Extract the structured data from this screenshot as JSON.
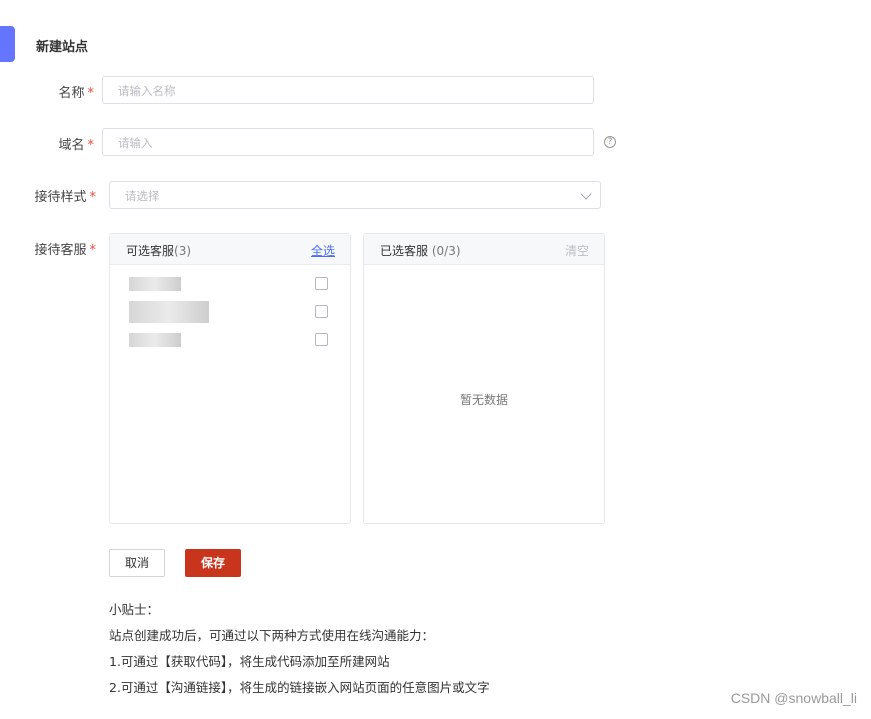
{
  "page": {
    "title": "新建站点"
  },
  "form": {
    "name": {
      "label": "名称",
      "required": "*",
      "placeholder": "请输入名称"
    },
    "domain": {
      "label": "域名",
      "required": "*",
      "placeholder": "请输入",
      "help": "?"
    },
    "style": {
      "label": "接待样式",
      "required": "*",
      "placeholder": "请选择"
    },
    "agents": {
      "label": "接待客服",
      "required": "*"
    }
  },
  "transfer": {
    "left": {
      "title": "可选客服",
      "count": "(3)",
      "action": "全选"
    },
    "right": {
      "title": "已选客服",
      "count": " (0/3)",
      "action": "清空",
      "empty": "暂无数据"
    }
  },
  "buttons": {
    "cancel": "取消",
    "save": "保存"
  },
  "tips": {
    "heading": "小贴士：",
    "line1": "站点创建成功后，可通过以下两种方式使用在线沟通能力：",
    "line2": "1.可通过【获取代码】，将生成代码添加至所建网站",
    "line3": "2.可通过【沟通链接】，将生成的链接嵌入网站页面的任意图片或文字"
  },
  "watermark": "CSDN @snowball_li",
  "colors": {
    "accent": "#6675ff",
    "link": "#4a6cf7",
    "primary": "#c9341c",
    "required": "#f04a3a"
  }
}
